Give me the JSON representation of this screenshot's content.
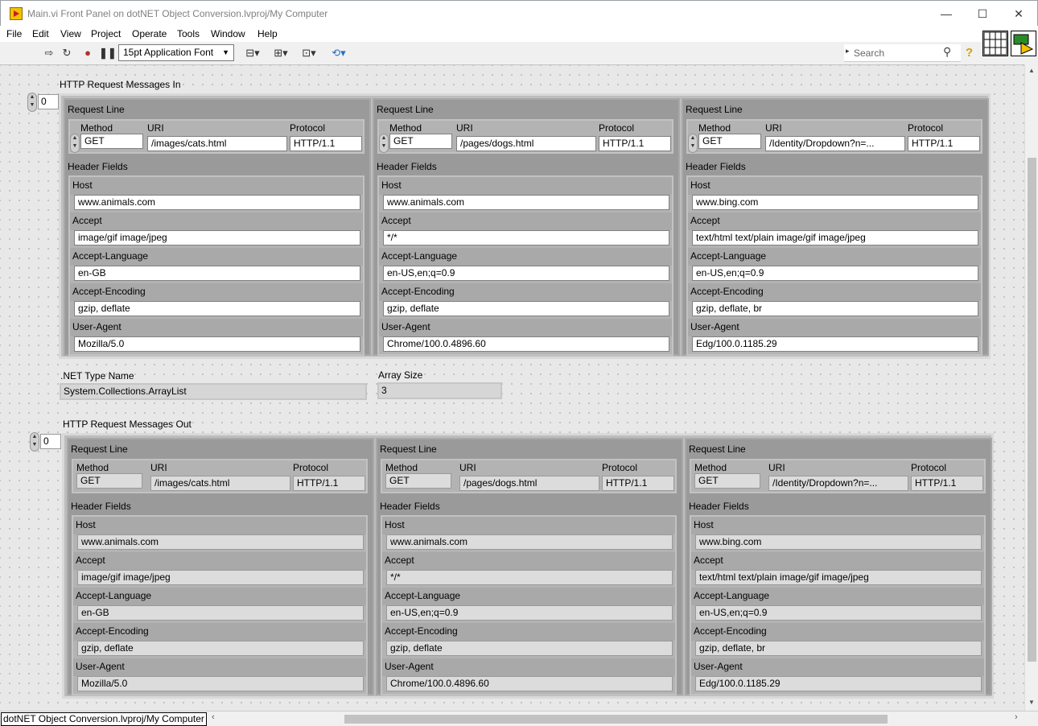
{
  "window": {
    "title": "Main.vi Front Panel on dotNET Object Conversion.lvproj/My Computer",
    "minimize": "—",
    "maximize": "☐",
    "close": "✕"
  },
  "menu": [
    "File",
    "Edit",
    "View",
    "Project",
    "Operate",
    "Tools",
    "Window",
    "Help"
  ],
  "toolbar": {
    "font": "15pt Application Font",
    "search_placeholder": "Search",
    "help": "?"
  },
  "http_in": {
    "label": "HTTP Request Messages In",
    "index": "0",
    "request_line_label": "Request Line",
    "method_label": "Method",
    "uri_label": "URI",
    "protocol_label": "Protocol",
    "header_fields_label": "Header Fields",
    "header_names": [
      "Host",
      "Accept",
      "Accept-Language",
      "Accept-Encoding",
      "User-Agent"
    ],
    "messages": [
      {
        "method": "GET",
        "uri": "/images/cats.html",
        "protocol": "HTTP/1.1",
        "headers": [
          "www.animals.com",
          "image/gif image/jpeg",
          "en-GB",
          "gzip, deflate",
          "Mozilla/5.0"
        ]
      },
      {
        "method": "GET",
        "uri": "/pages/dogs.html",
        "protocol": "HTTP/1.1",
        "headers": [
          "www.animals.com",
          "*/*",
          "en-US,en;q=0.9",
          "gzip, deflate",
          "Chrome/100.0.4896.60"
        ]
      },
      {
        "method": "GET",
        "uri": "/Identity/Dropdown?n=...",
        "protocol": "HTTP/1.1",
        "headers": [
          "www.bing.com",
          "text/html text/plain image/gif image/jpeg",
          "en-US,en;q=0.9",
          "gzip, deflate, br",
          "Edg/100.0.1185.29"
        ]
      }
    ]
  },
  "net_type": {
    "label": ".NET Type Name",
    "value": "System.Collections.ArrayList"
  },
  "array_size": {
    "label": "Array Size",
    "value": "3"
  },
  "http_out": {
    "label": "HTTP Request Messages Out",
    "index": "0",
    "request_line_label": "Request Line",
    "method_label": "Method",
    "uri_label": "URI",
    "protocol_label": "Protocol",
    "header_fields_label": "Header Fields",
    "header_names": [
      "Host",
      "Accept",
      "Accept-Language",
      "Accept-Encoding",
      "User-Agent"
    ],
    "messages": [
      {
        "method": "GET",
        "uri": "/images/cats.html",
        "protocol": "HTTP/1.1",
        "headers": [
          "www.animals.com",
          "image/gif image/jpeg",
          "en-GB",
          "gzip, deflate",
          "Mozilla/5.0"
        ]
      },
      {
        "method": "GET",
        "uri": "/pages/dogs.html",
        "protocol": "HTTP/1.1",
        "headers": [
          "www.animals.com",
          "*/*",
          "en-US,en;q=0.9",
          "gzip, deflate",
          "Chrome/100.0.4896.60"
        ]
      },
      {
        "method": "GET",
        "uri": "/Identity/Dropdown?n=...",
        "protocol": "HTTP/1.1",
        "headers": [
          "www.bing.com",
          "text/html text/plain image/gif image/jpeg",
          "en-US,en;q=0.9",
          "gzip, deflate, br",
          "Edg/100.0.1185.29"
        ]
      }
    ]
  },
  "status": {
    "context": "dotNET Object Conversion.lvproj/My Computer"
  }
}
